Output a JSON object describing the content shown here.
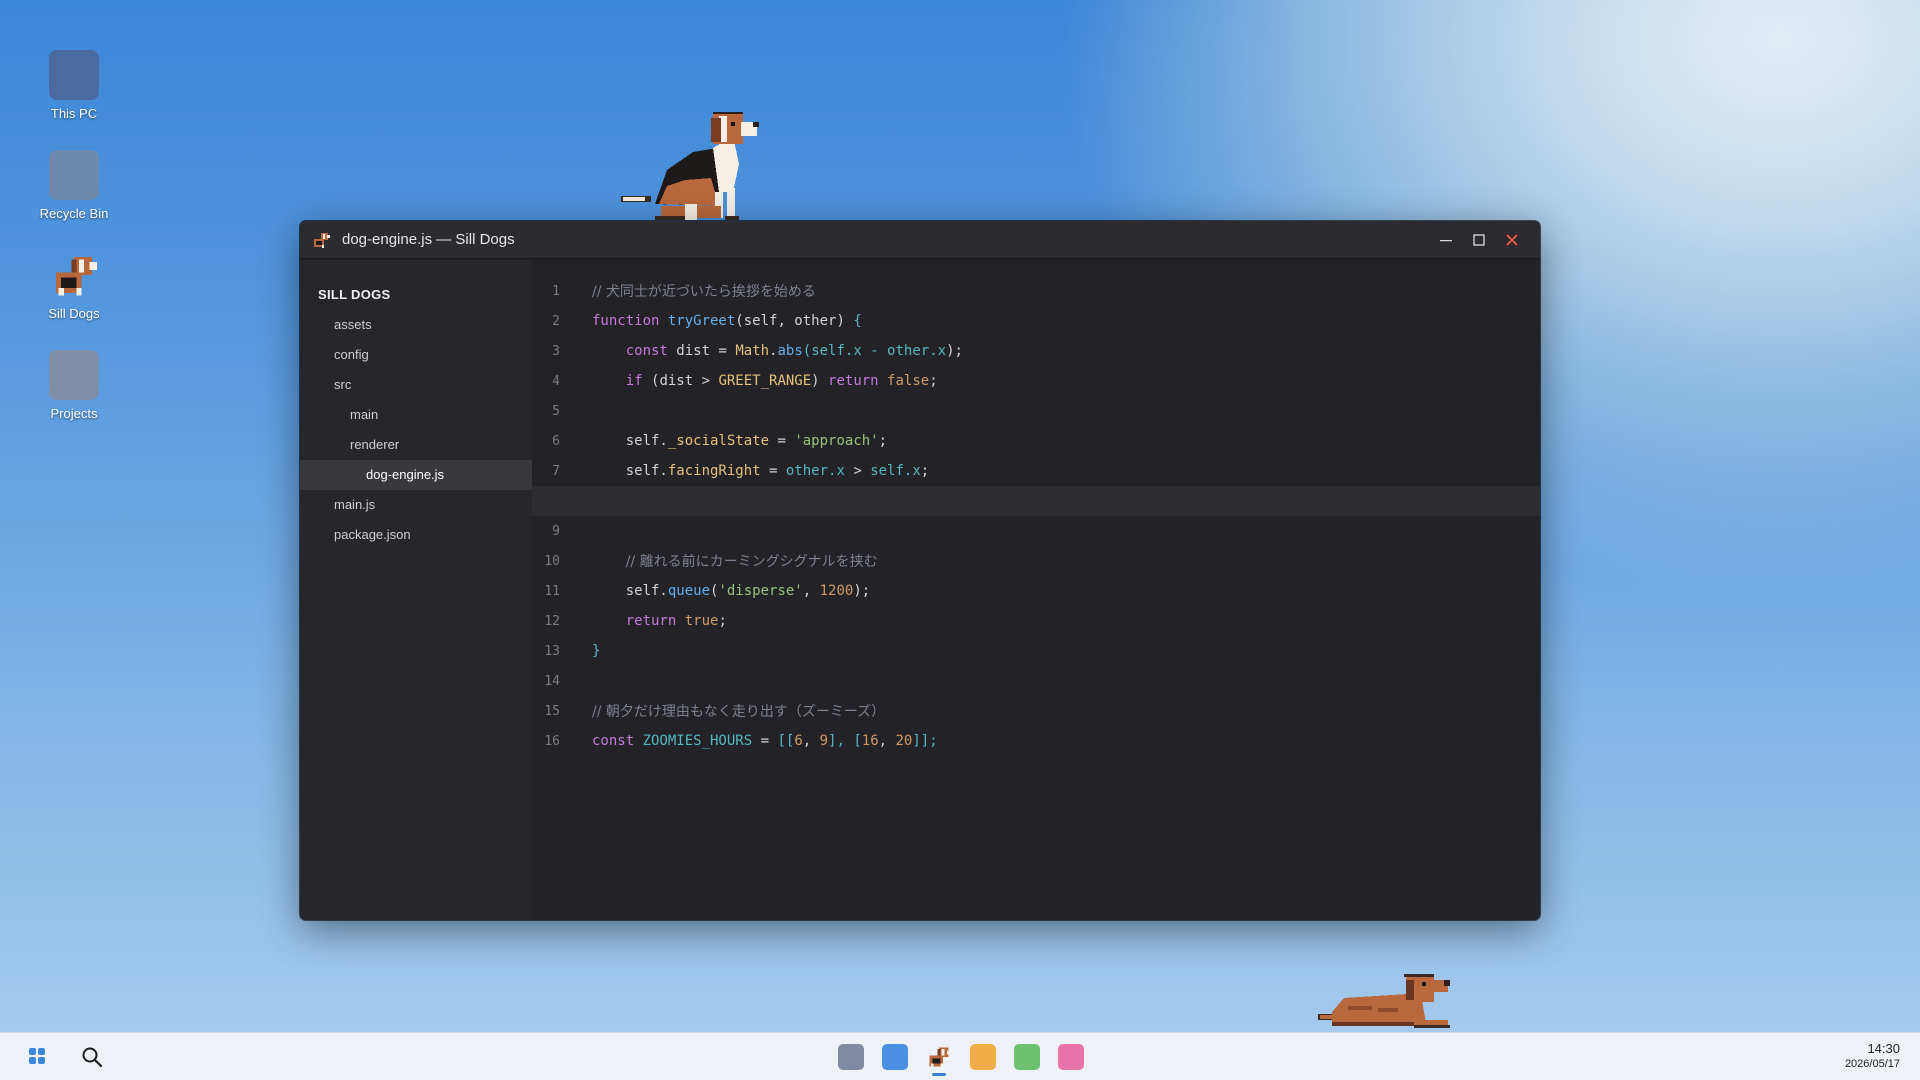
{
  "desktop": {
    "icons": [
      {
        "label": "This PC",
        "color": "#4a6aa0"
      },
      {
        "label": "Recycle Bin",
        "color": "#6f89ad"
      },
      {
        "label": "Sill Dogs",
        "icon": "beagle-pixel-icon"
      },
      {
        "label": "Projects",
        "color": "#7e8ea6"
      }
    ]
  },
  "window": {
    "title": "dog-engine.js — Sill Dogs",
    "controls": {
      "minimize": "minimize-icon",
      "maximize": "maximize-icon",
      "close": "close-icon"
    }
  },
  "sidebar": {
    "header": "SILL DOGS",
    "items": [
      {
        "label": "assets",
        "depth": 1
      },
      {
        "label": "config",
        "depth": 1
      },
      {
        "label": "src",
        "depth": 1
      },
      {
        "label": "main",
        "depth": 2
      },
      {
        "label": "renderer",
        "depth": 2
      },
      {
        "label": "dog-engine.js",
        "depth": 3,
        "active": true
      },
      {
        "label": "main.js",
        "depth": 1
      },
      {
        "label": "package.json",
        "depth": 1
      }
    ]
  },
  "editor": {
    "lines": [
      {
        "n": "1",
        "code": [
          {
            "t": "// 犬同士が近づいたら挨拶を始める",
            "c": "cmt"
          }
        ]
      },
      {
        "n": "2",
        "code": [
          {
            "t": "function ",
            "c": "kw"
          },
          {
            "t": "tryGreet",
            "c": "fn"
          },
          {
            "t": "(self, other) ",
            "c": ""
          },
          {
            "t": "{",
            "c": "punc"
          }
        ]
      },
      {
        "n": "3",
        "code": [
          {
            "t": "    ",
            "c": ""
          },
          {
            "t": "const ",
            "c": "kw"
          },
          {
            "t": "dist = ",
            "c": ""
          },
          {
            "t": "Math",
            "c": "const"
          },
          {
            "t": ".",
            "c": ""
          },
          {
            "t": "abs",
            "c": "fn"
          },
          {
            "t": "(",
            "c": "punc"
          },
          {
            "t": "self.x - other.x",
            "c": "punc"
          },
          {
            "t": ");",
            "c": ""
          }
        ]
      },
      {
        "n": "4",
        "code": [
          {
            "t": "    ",
            "c": ""
          },
          {
            "t": "if ",
            "c": "kw"
          },
          {
            "t": "(dist > ",
            "c": ""
          },
          {
            "t": "GREET_RANGE",
            "c": "const"
          },
          {
            "t": ") ",
            "c": ""
          },
          {
            "t": "return ",
            "c": "kw"
          },
          {
            "t": "false",
            "c": "num"
          },
          {
            "t": ";",
            "c": ""
          }
        ]
      },
      {
        "n": "5",
        "code": []
      },
      {
        "n": "6",
        "code": [
          {
            "t": "    self.",
            "c": ""
          },
          {
            "t": "_socialState",
            "c": "prop"
          },
          {
            "t": " = ",
            "c": ""
          },
          {
            "t": "'approach'",
            "c": "str"
          },
          {
            "t": ";",
            "c": ""
          }
        ]
      },
      {
        "n": "7",
        "code": [
          {
            "t": "    self.",
            "c": ""
          },
          {
            "t": "facingRight",
            "c": "prop"
          },
          {
            "t": " = ",
            "c": ""
          },
          {
            "t": "other.x",
            "c": "punc"
          },
          {
            "t": " > ",
            "c": ""
          },
          {
            "t": "self.x",
            "c": "punc"
          },
          {
            "t": ";",
            "c": ""
          }
        ]
      },
      {
        "n": "",
        "code": [],
        "current": true
      },
      {
        "n": "9",
        "code": []
      },
      {
        "n": "10",
        "code": [
          {
            "t": "    ",
            "c": ""
          },
          {
            "t": "// 離れる前にカーミングシグナルを挟む",
            "c": "cmt"
          }
        ]
      },
      {
        "n": "11",
        "code": [
          {
            "t": "    self.",
            "c": ""
          },
          {
            "t": "queue",
            "c": "fn"
          },
          {
            "t": "(",
            "c": ""
          },
          {
            "t": "'disperse'",
            "c": "str"
          },
          {
            "t": ", ",
            "c": ""
          },
          {
            "t": "1200",
            "c": "num"
          },
          {
            "t": ");",
            "c": ""
          }
        ]
      },
      {
        "n": "12",
        "code": [
          {
            "t": "    ",
            "c": ""
          },
          {
            "t": "return ",
            "c": "kw"
          },
          {
            "t": "true",
            "c": "num"
          },
          {
            "t": ";",
            "c": ""
          }
        ]
      },
      {
        "n": "13",
        "code": [
          {
            "t": "}",
            "c": "punc"
          }
        ]
      },
      {
        "n": "14",
        "code": []
      },
      {
        "n": "15",
        "code": [
          {
            "t": "// 朝夕だけ理由もなく走り出す（ズーミーズ）",
            "c": "cmt"
          }
        ]
      },
      {
        "n": "16",
        "code": [
          {
            "t": "const ",
            "c": "kw"
          },
          {
            "t": "ZOOMIES_HOURS",
            "c": "punc"
          },
          {
            "t": " = ",
            "c": ""
          },
          {
            "t": "[[",
            "c": "punc"
          },
          {
            "t": "6",
            "c": "num"
          },
          {
            "t": ", ",
            "c": ""
          },
          {
            "t": "9",
            "c": "num"
          },
          {
            "t": "], [",
            "c": "punc"
          },
          {
            "t": "16",
            "c": "num"
          },
          {
            "t": ", ",
            "c": ""
          },
          {
            "t": "20",
            "c": "num"
          },
          {
            "t": "]];",
            "c": "punc"
          }
        ]
      }
    ]
  },
  "taskbar": {
    "apps": [
      {
        "name": "app-grey",
        "color": "#7f8aa3"
      },
      {
        "name": "app-blue",
        "color": "#4a90e2"
      },
      {
        "name": "app-sill-dogs",
        "icon": "beagle-pixel-icon",
        "active": true
      },
      {
        "name": "app-orange",
        "color": "#f2ac48"
      },
      {
        "name": "app-green",
        "color": "#6cc070"
      },
      {
        "name": "app-pink",
        "color": "#e873a9"
      }
    ],
    "time": "14:30",
    "date": "2026/05/17"
  }
}
